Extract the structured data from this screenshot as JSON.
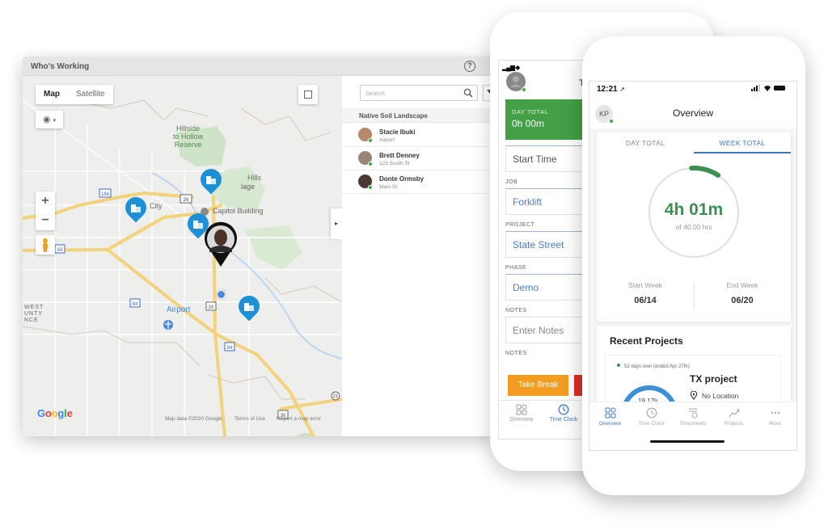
{
  "desktop": {
    "title": "Who's Working",
    "help_icon": "help-circle-icon",
    "map": {
      "type_options": [
        "Map",
        "Satellite"
      ],
      "selected_type": "Map",
      "labels": {
        "reserve": [
          "Hillside",
          "to Hollow",
          "Reserve"
        ],
        "hills": "Hills",
        "village": "lage",
        "city": "City",
        "capitol": "Capitol Building",
        "airport": "Airport",
        "county": [
          "WEST",
          "UNTY",
          "NCE"
        ]
      },
      "highway_shields": [
        "184",
        "26",
        "84",
        "84",
        "20",
        "84",
        "30",
        "21"
      ],
      "google_logo": [
        "G",
        "o",
        "o",
        "g",
        "l",
        "e"
      ],
      "google_colors": [
        "#4285f4",
        "#ea4335",
        "#fbbc05",
        "#4285f4",
        "#34a853",
        "#ea4335"
      ],
      "footer": {
        "map_data": "Map data ©2020 Google",
        "terms": "Terms of Use",
        "report": "Report a map error"
      },
      "zoom_in": "+",
      "zoom_out": "−",
      "collapse_arrow": "▸"
    },
    "side": {
      "search_placeholder": "Search",
      "group": "Native Soil Landscape",
      "workers": [
        {
          "name": "Stacie Ibuki",
          "location": "Airport"
        },
        {
          "name": "Brett Denney",
          "location": "123 South St"
        },
        {
          "name": "Donte Ormsby",
          "location": "Main St"
        }
      ]
    }
  },
  "phone1": {
    "title": "T",
    "day_total_label": "DAY TOTAL",
    "day_total_value": "0h 00m",
    "start_time": "Start Time",
    "fields": [
      {
        "label": "JOB",
        "value": "Forklift"
      },
      {
        "label": "PROJECT",
        "value": "State Street"
      },
      {
        "label": "PHASE",
        "value": "Demo"
      },
      {
        "label": "NOTES",
        "value": "Enter Notes"
      }
    ],
    "notes_label_2": "NOTES",
    "take_break": "Take Break",
    "tabs": [
      {
        "label": "Overview",
        "active": false
      },
      {
        "label": "Time Clock",
        "active": true
      }
    ]
  },
  "phone2": {
    "status_time": "12:21",
    "status_icons": "signal wifi battery",
    "avatar_initials": "KP",
    "title": "Overview",
    "tabs": {
      "day": "DAY TOTAL",
      "week": "WEEK TOTAL"
    },
    "week_total": "4h 01m",
    "week_goal": "of 40.00 hrs",
    "week_progress_fraction": 0.1,
    "start_week_label": "Start Week",
    "start_week": "06/14",
    "end_week_label": "End Week",
    "end_week": "06/20",
    "recent_title": "Recent Projects",
    "project": {
      "status": "52 days over (ended Apr 27th)",
      "name": "TX  project",
      "location": "No Location",
      "hours": "19.17h"
    },
    "nav": [
      {
        "label": "Overview",
        "active": true
      },
      {
        "label": "Time Clock",
        "active": false
      },
      {
        "label": "Timesheets",
        "active": false
      },
      {
        "label": "Projects",
        "active": false
      },
      {
        "label": "More",
        "active": false
      }
    ]
  },
  "colors": {
    "accent_blue": "#3a79c2",
    "day_total_green": "#43a047",
    "progress_green": "#3f8f52",
    "break_orange": "#f39c1f",
    "stop_red": "#d93025",
    "pin_blue": "#1e90d8"
  }
}
